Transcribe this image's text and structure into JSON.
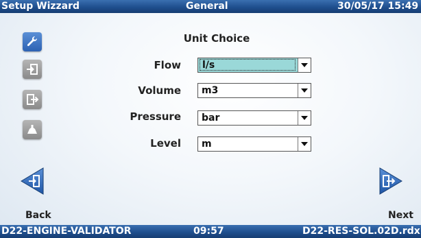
{
  "header": {
    "app_title": "Setup Wizzard",
    "section": "General",
    "datetime": "30/05/17 15:49"
  },
  "sidebar": {
    "items": [
      {
        "icon": "wrench-icon",
        "active": true
      },
      {
        "icon": "import-icon",
        "active": false
      },
      {
        "icon": "export-icon",
        "active": false
      },
      {
        "icon": "pump-icon",
        "active": false
      }
    ]
  },
  "main": {
    "title": "Unit Choice",
    "fields": [
      {
        "label": "Flow",
        "value": "l/s"
      },
      {
        "label": "Volume",
        "value": "m3"
      },
      {
        "label": "Pressure",
        "value": "bar"
      },
      {
        "label": "Level",
        "value": "m"
      }
    ]
  },
  "nav": {
    "back_label": "Back",
    "next_label": "Next"
  },
  "footer": {
    "left": "D22-ENGINE-VALIDATOR",
    "center": "09:57",
    "right": "D22-RES-SOL.02D.rdx"
  },
  "colors": {
    "bar": "#1f4f8e",
    "active_icon": "#3a72c4",
    "selected_field": "#9ad8d8"
  }
}
